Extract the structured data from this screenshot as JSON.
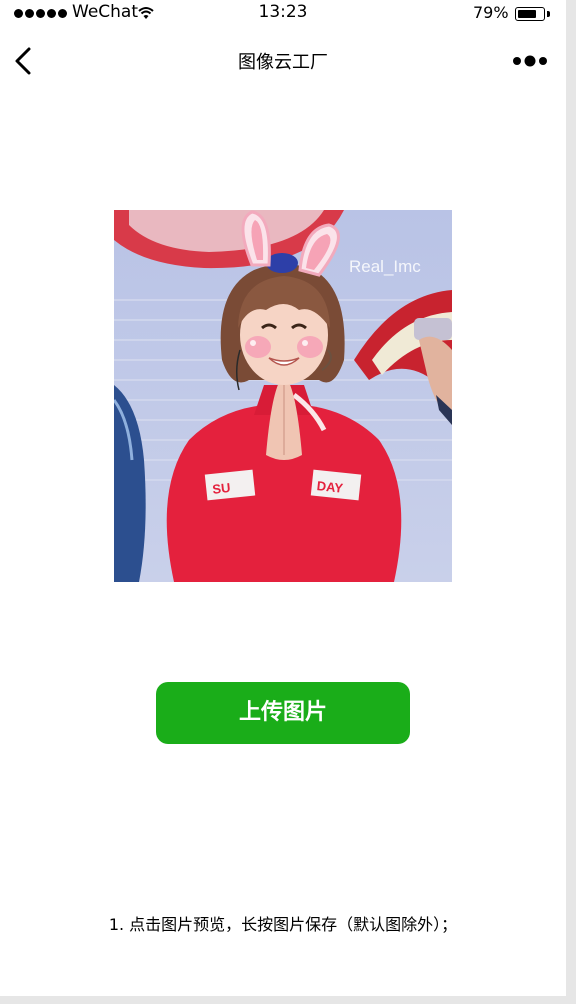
{
  "status_bar": {
    "carrier": "WeChat",
    "time": "13:23",
    "battery_percent_text": "79%",
    "battery_level": 0.79
  },
  "nav": {
    "title": "图像云工厂",
    "back_icon": "chevron-left-icon",
    "more_icon": "more-dots-icon"
  },
  "photo": {
    "watermark": "Real_Imc",
    "shirt_text_left": "SU",
    "shirt_text_right": "DAY"
  },
  "upload_button": {
    "label": "上传图片",
    "color": "#1aad19"
  },
  "hint": {
    "text": "1. 点击图片预览，长按图片保存（默认图除外）；"
  }
}
